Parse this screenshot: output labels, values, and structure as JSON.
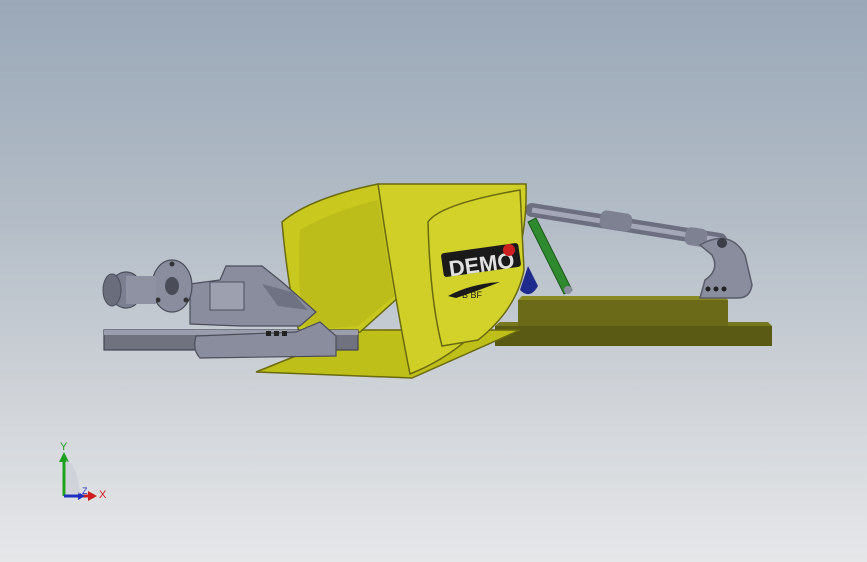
{
  "viewport": {
    "background_top": "#9aa8b8",
    "background_bottom": "#e6e7e9"
  },
  "model": {
    "logo_text": "DEMO",
    "logo_subtext": "B BF",
    "body_color": "#c8c81e",
    "base_color": "#5a5a14",
    "metal_color": "#8a8d9e",
    "link_color": "#2f8a2f",
    "knob_color": "#1e2a8c"
  },
  "triad": {
    "x_label": "X",
    "y_label": "Y",
    "z_label": "Z",
    "x_color": "#cc2020",
    "y_color": "#20a020",
    "z_color": "#2030c0"
  }
}
